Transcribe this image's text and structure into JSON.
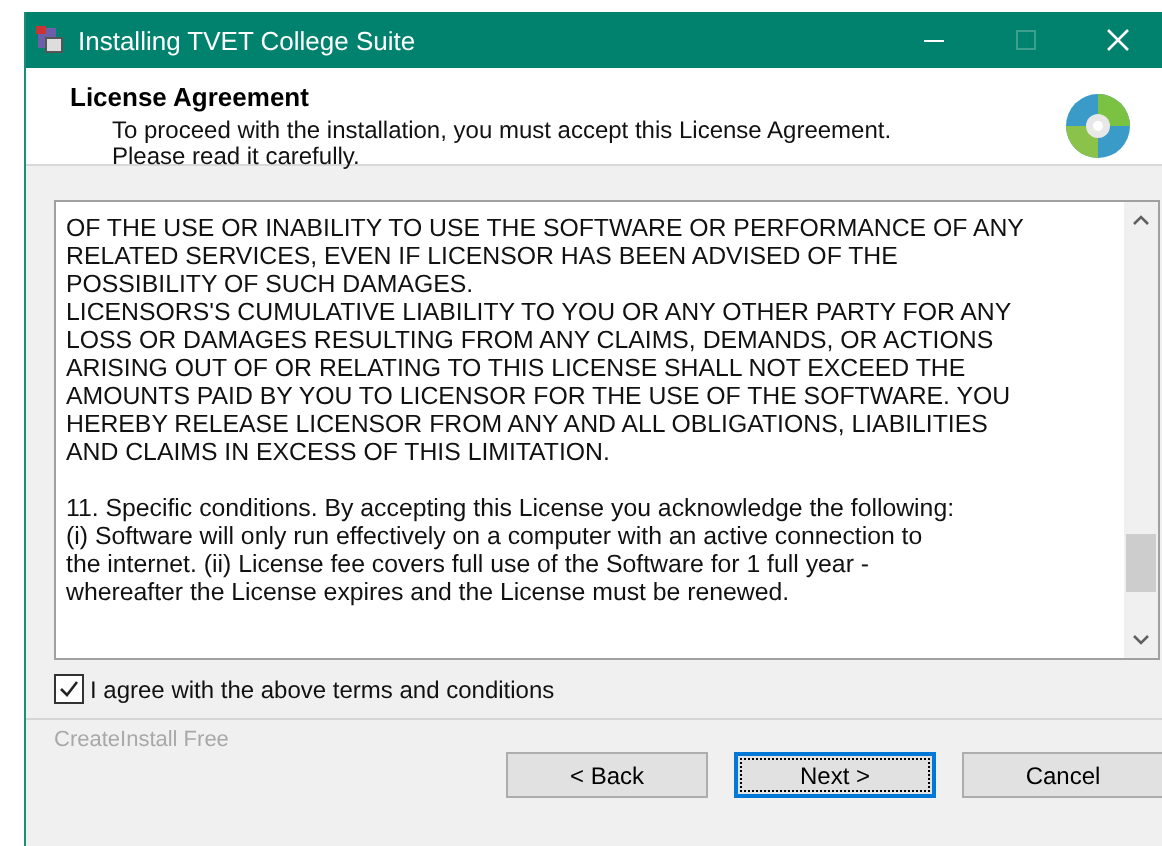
{
  "window": {
    "title": "Installing TVET College Suite"
  },
  "header": {
    "title": "License Agreement",
    "subtitle": "To proceed with the installation, you must accept this License Agreement. Please read it carefully."
  },
  "license_text": [
    {
      "lines": [
        "OF THE USE OR INABILITY TO USE THE SOFTWARE OR PERFORMANCE OF ANY",
        "RELATED SERVICES, EVEN IF LICENSOR HAS BEEN ADVISED OF THE",
        "POSSIBILITY OF SUCH DAMAGES.",
        "LICENSORS'S CUMULATIVE LIABILITY TO YOU OR ANY OTHER PARTY FOR ANY",
        "LOSS OR DAMAGES RESULTING FROM ANY CLAIMS, DEMANDS, OR ACTIONS",
        "ARISING OUT OF OR RELATING TO THIS LICENSE SHALL NOT EXCEED THE",
        "AMOUNTS PAID BY YOU TO LICENSOR FOR THE USE OF THE SOFTWARE. YOU",
        "HEREBY RELEASE LICENSOR FROM ANY AND ALL OBLIGATIONS, LIABILITIES",
        "AND CLAIMS IN EXCESS OF THIS LIMITATION."
      ]
    },
    {
      "lines": [
        "11. Specific conditions. By accepting this License you acknowledge the following:",
        "(i) Software will only run effectively on a computer with an active connection to",
        "the internet. (ii) License fee covers full use of the Software for 1 full year -",
        "whereafter the License expires and the License must be renewed."
      ]
    }
  ],
  "agree": {
    "label": "I agree with the above terms and conditions",
    "checked": true
  },
  "brand": "CreateInstall Free",
  "buttons": [
    {
      "label": "< Back",
      "focused": false
    },
    {
      "label": "Next >",
      "focused": true
    },
    {
      "label": "Cancel",
      "focused": false
    }
  ]
}
